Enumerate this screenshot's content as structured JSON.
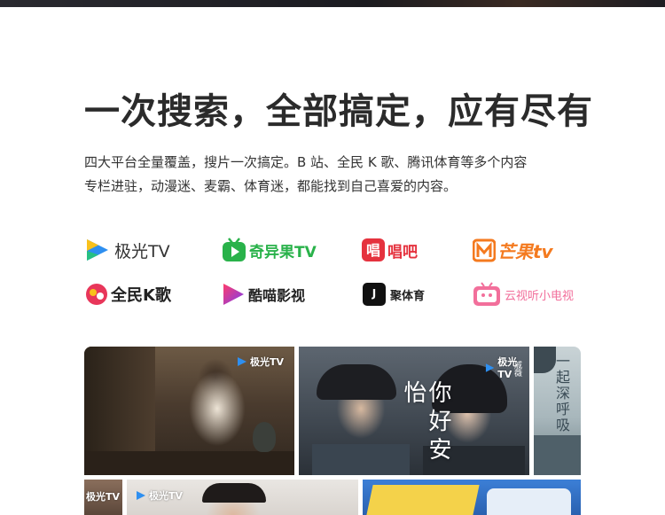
{
  "headline": "一次搜索，全部搞定，应有尽有",
  "description_line1": "四大平台全量覆盖，搜片一次搞定。B 站、全民 K 歌、腾讯体育等多个内容",
  "description_line2": "专栏进驻，动漫迷、麦霸、体育迷，都能找到自己喜爱的内容。",
  "apps": [
    {
      "name": "极光TV",
      "icon": "jiguang-tv-icon",
      "color": "#2e8ff0"
    },
    {
      "name": "奇异果TV",
      "icon": "kiwi-tv-icon",
      "color": "#29b24a"
    },
    {
      "name": "唱吧",
      "icon": "changba-icon",
      "color": "#e5323e"
    },
    {
      "name": "芒果tv",
      "icon": "mango-tv-icon",
      "color": "#f47a1f"
    },
    {
      "name": "全民K歌",
      "icon": "quanmin-kge-icon",
      "color": "#e8365a"
    },
    {
      "name": "酷喵影视",
      "icon": "kumiao-icon",
      "color": "#8b3bf0"
    },
    {
      "name": "聚体育",
      "icon": "ju-sports-icon",
      "color": "#111111"
    },
    {
      "name": "云视听小电视",
      "icon": "bilibili-tv-icon",
      "color": "#f26f9b"
    }
  ],
  "posters": {
    "watermark": "极光TV",
    "poster2_title": "你好安怡",
    "poster3_title": "一起深呼吸",
    "poster2_side_text": "戚薇"
  }
}
